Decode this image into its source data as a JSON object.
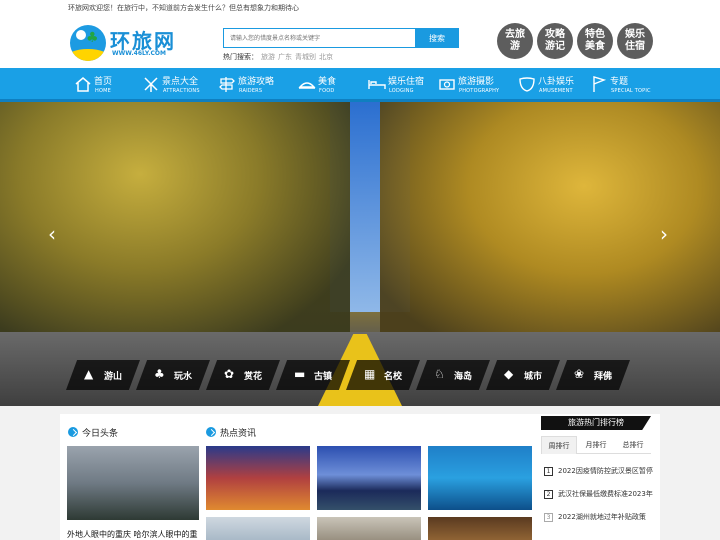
{
  "topbar": {
    "welcome": "环旅网欢迎您！在旅行中，不知道前方会发生什么？但总有想象力和期待心"
  },
  "brand": {
    "name": "环旅网",
    "url": "WWW.46LY.COM",
    "accent": "#1a9ae0",
    "nav_color": "#1aa0e6"
  },
  "search": {
    "placeholder": "请输入您的惜度景点名称或关键字",
    "button": "搜索",
    "hot_label": "热门搜索：",
    "hot_terms": [
      "旅游",
      "广东",
      "青城别",
      "北京"
    ]
  },
  "quick_links": [
    "去旅游",
    "攻略游记",
    "特色美食",
    "娱乐住宿"
  ],
  "nav": [
    {
      "cn": "首页",
      "en": "HOME",
      "icon": "house-icon"
    },
    {
      "cn": "景点大全",
      "en": "ATTRACTIONS",
      "icon": "windmill-icon"
    },
    {
      "cn": "旅游攻略",
      "en": "RAIDERS",
      "icon": "signpost-icon"
    },
    {
      "cn": "美食",
      "en": "FOOD",
      "icon": "dish-icon"
    },
    {
      "cn": "娱乐住宿",
      "en": "LODGING",
      "icon": "bed-icon"
    },
    {
      "cn": "旅游摄影",
      "en": "PHOTOGRAPHY",
      "icon": "camera-icon"
    },
    {
      "cn": "八卦娱乐",
      "en": "AMUSEMENT",
      "icon": "mask-icon"
    },
    {
      "cn": "专题",
      "en": "SPECIAL TOPIC",
      "icon": "flag-icon"
    }
  ],
  "banner": {
    "prev": "‹",
    "next": "›",
    "categories": [
      {
        "label": "游山",
        "icon": "mountain-icon",
        "glyph": "▲"
      },
      {
        "label": "玩水",
        "icon": "palm-icon",
        "glyph": "♣"
      },
      {
        "label": "赏花",
        "icon": "flower-icon",
        "glyph": "✿"
      },
      {
        "label": "古镇",
        "icon": "town-icon",
        "glyph": "▬"
      },
      {
        "label": "名校",
        "icon": "school-icon",
        "glyph": "▦"
      },
      {
        "label": "海岛",
        "icon": "kangaroo-icon",
        "glyph": "♘"
      },
      {
        "label": "城市",
        "icon": "map-icon",
        "glyph": "◆"
      },
      {
        "label": "拜佛",
        "icon": "lotus-icon",
        "glyph": "❀"
      }
    ]
  },
  "sections": {
    "headline": {
      "title": "今日头条",
      "caption": "外地人眼中的重庆 哈尔滨人眼中的重庆"
    },
    "hot_news": {
      "title": "热点资讯"
    },
    "ranking": {
      "title": "旅游热门排行榜",
      "tabs": [
        "周排行",
        "月排行",
        "总排行"
      ],
      "items": [
        {
          "num": "1",
          "text": "2022因疫情防控武汉景区暂停"
        },
        {
          "num": "2",
          "text": "武汉社保最低缴费标准2023年"
        },
        {
          "num": "3",
          "text": "2022湖州就地过年补贴政策"
        }
      ]
    }
  }
}
